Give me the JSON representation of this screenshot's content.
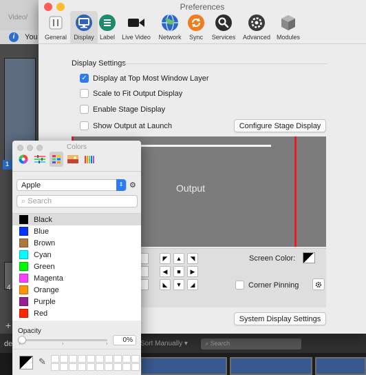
{
  "background": {
    "video_label": "Video/",
    "info_text": "You",
    "left_badge": "1",
    "lower_left_number": "4",
    "plus_label": "+",
    "bottom_de": "de",
    "sort_label": "Sort Manually",
    "search_placeholder": "Search"
  },
  "preferences": {
    "title": "Preferences",
    "toolbar": [
      {
        "label": "General",
        "icon": "general-icon"
      },
      {
        "label": "Display",
        "icon": "display-icon"
      },
      {
        "label": "Label",
        "icon": "label-icon"
      },
      {
        "label": "Live Video",
        "icon": "live-video-icon"
      },
      {
        "label": "Network",
        "icon": "network-icon"
      },
      {
        "label": "Sync",
        "icon": "sync-icon"
      },
      {
        "label": "Services",
        "icon": "services-icon"
      },
      {
        "label": "Advanced",
        "icon": "advanced-icon"
      },
      {
        "label": "Modules",
        "icon": "modules-icon"
      }
    ],
    "selected_tab": "Display",
    "section_title": "Display Settings",
    "options": [
      {
        "label": "Display at Top Most Window Layer",
        "checked": true
      },
      {
        "label": "Scale to Fit Output Display",
        "checked": false
      },
      {
        "label": "Enable Stage Display",
        "checked": false
      },
      {
        "label": "Show Output at Launch",
        "checked": false
      }
    ],
    "configure_stage_button": "Configure Stage Display",
    "output_label": "Output",
    "screen_color_label": "Screen Color:",
    "corner_pinning_label": "Corner Pinning",
    "system_display_button": "System Display Settings",
    "accent_color": "#2d7bf4",
    "output_border_color": "#ed1c24"
  },
  "colors_panel": {
    "title": "Colors",
    "palette_select": "Apple",
    "search_placeholder": "Search",
    "items": [
      {
        "name": "Black",
        "color": "#000000"
      },
      {
        "name": "Blue",
        "color": "#0433ff"
      },
      {
        "name": "Brown",
        "color": "#aa7942"
      },
      {
        "name": "Cyan",
        "color": "#00fdff"
      },
      {
        "name": "Green",
        "color": "#00f900"
      },
      {
        "name": "Magenta",
        "color": "#ff40ff"
      },
      {
        "name": "Orange",
        "color": "#ff9300"
      },
      {
        "name": "Purple",
        "color": "#942192"
      },
      {
        "name": "Red",
        "color": "#ff2600"
      }
    ],
    "selected_item": "Black",
    "opacity_label": "Opacity",
    "opacity_value": "0%"
  }
}
